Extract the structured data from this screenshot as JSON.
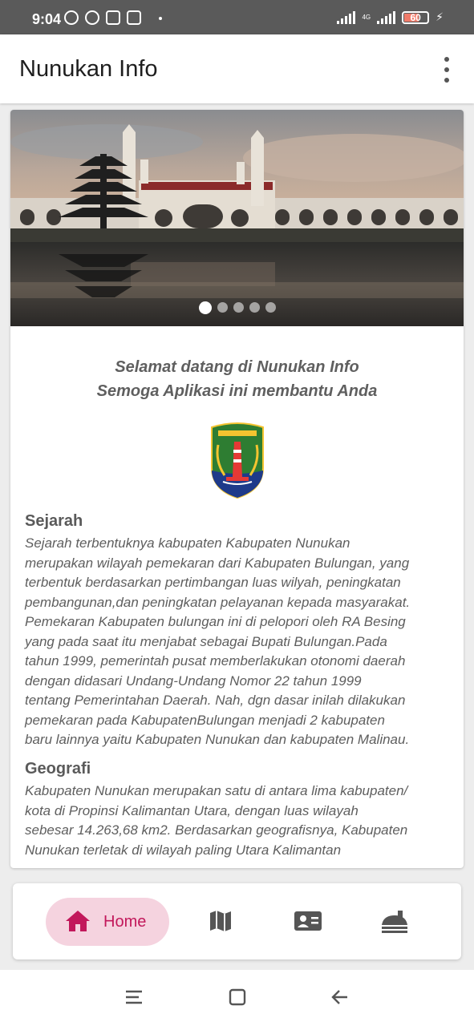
{
  "status_bar": {
    "time": "9:04",
    "network": "4G",
    "battery_level": "60",
    "battery_fraction": 0.6
  },
  "app_bar": {
    "title": "Nunukan Info",
    "menu_icon": "more-vert-icon"
  },
  "carousel": {
    "slide_count": 5,
    "active_index": 0
  },
  "welcome": {
    "line1": "Selamat datang di Nunukan Info",
    "line2": "Semoga Aplikasi ini membantu Anda"
  },
  "sections": [
    {
      "title": "Sejarah",
      "lines": [
        "Sejarah terbentuknya kabupaten Kabupaten Nunukan",
        "merupakan wilayah pemekaran dari Kabupaten Bulungan, yang",
        "terbentuk berdasarkan pertimbangan luas wilyah, peningkatan",
        "pembangunan,dan peningkatan pelayanan kepada masyarakat.",
        "Pemekaran Kabupaten bulungan ini di pelopori oleh RA Besing",
        "yang pada saat itu menjabat sebagai Bupati Bulungan.Pada",
        "tahun 1999, pemerintah pusat memberlakukan otonomi daerah",
        "dengan didasari Undang-Undang Nomor 22 tahun 1999",
        "tentang Pemerintahan Daerah. Nah, dgn dasar inilah dilakukan",
        "pemekaran pada KabupatenBulungan menjadi 2 kabupaten",
        "baru lainnya yaitu Kabupaten Nunukan dan kabupaten Malinau."
      ]
    },
    {
      "title": "Geografi",
      "lines": [
        "Kabupaten Nunukan merupakan satu di antara lima kabupaten/",
        "kota di Propinsi Kalimantan Utara, dengan luas wilayah",
        "sebesar 14.263,68 km2. Berdasarkan geografisnya, Kabupaten",
        "Nunukan terletak di wilayah paling Utara Kalimantan"
      ]
    }
  ],
  "bottom_nav": {
    "items": [
      {
        "label": "Home",
        "icon": "home-icon",
        "active": true
      },
      {
        "label": "",
        "icon": "map-icon",
        "active": false
      },
      {
        "label": "",
        "icon": "contact-card-icon",
        "active": false
      },
      {
        "label": "",
        "icon": "food-service-icon",
        "active": false
      }
    ],
    "accent": "#c2185b",
    "active_bg": "#f5d3df"
  },
  "system_nav": {
    "buttons": [
      "recent-apps-icon",
      "home-square-icon",
      "back-icon"
    ]
  }
}
